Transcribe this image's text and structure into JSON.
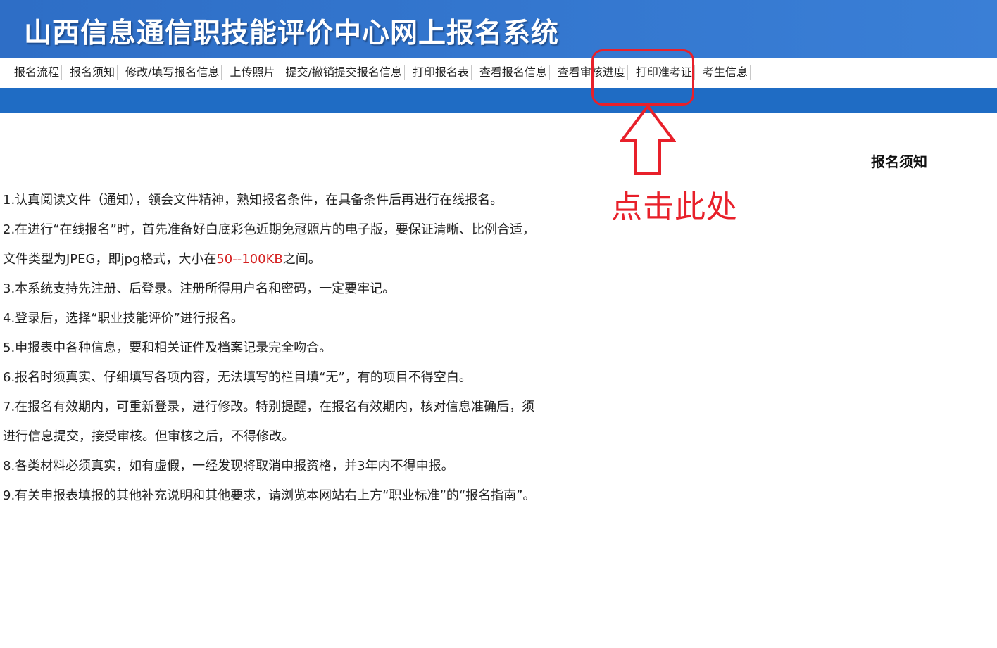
{
  "header": {
    "title": "山西信息通信职技能评价中心网上报名系统"
  },
  "nav": {
    "items": [
      "报名流程",
      "报名须知",
      "修改/填写报名信息",
      "上传照片",
      "提交/撤销提交报名信息",
      "打印报名表",
      "查看报名信息",
      "查看审核进度",
      "打印准考证",
      "考生信息"
    ]
  },
  "notice": {
    "heading": "报名须知",
    "items": [
      "1.认真阅读文件（通知），领会文件精神，熟知报名条件，在具备条件后再进行在线报名。",
      "2.在进行“在线报名”时，首先准备好白底彩色近期免冠照片的电子版，要保证清晰、比例合适，文件类型为JPEG，即jpg格式，大小在",
      "50--100KB",
      "之间。",
      "3.本系统支持先注册、后登录。注册所得用户名和密码，一定要牢记。",
      "4.登录后，选择“职业技能评价”进行报名。",
      "5.申报表中各种信息，要和相关证件及档案记录完全吻合。",
      "6.报名时须真实、仔细填写各项内容，无法填写的栏目填“无”，有的项目不得空白。",
      "7.在报名有效期内，可重新登录，进行修改。特别提醒，在报名有效期内，核对信息准确后，须进行信息提交，接受审核。但审核之后，不得修改。",
      "8.各类材料必须真实，如有虚假，一经发现将取消申报资格，并3年内不得申报。",
      "9.有关申报表填报的其他补充说明和其他要求，请浏览本网站右上方“职业标准”的“报名指南”。"
    ]
  },
  "annotation": {
    "text": "点击此处",
    "color": "#e8202a"
  },
  "colors": {
    "banner": "#3477cf",
    "stripe": "#1f6cc4",
    "highlight": "#e8202a",
    "size_note": "#d42020"
  }
}
